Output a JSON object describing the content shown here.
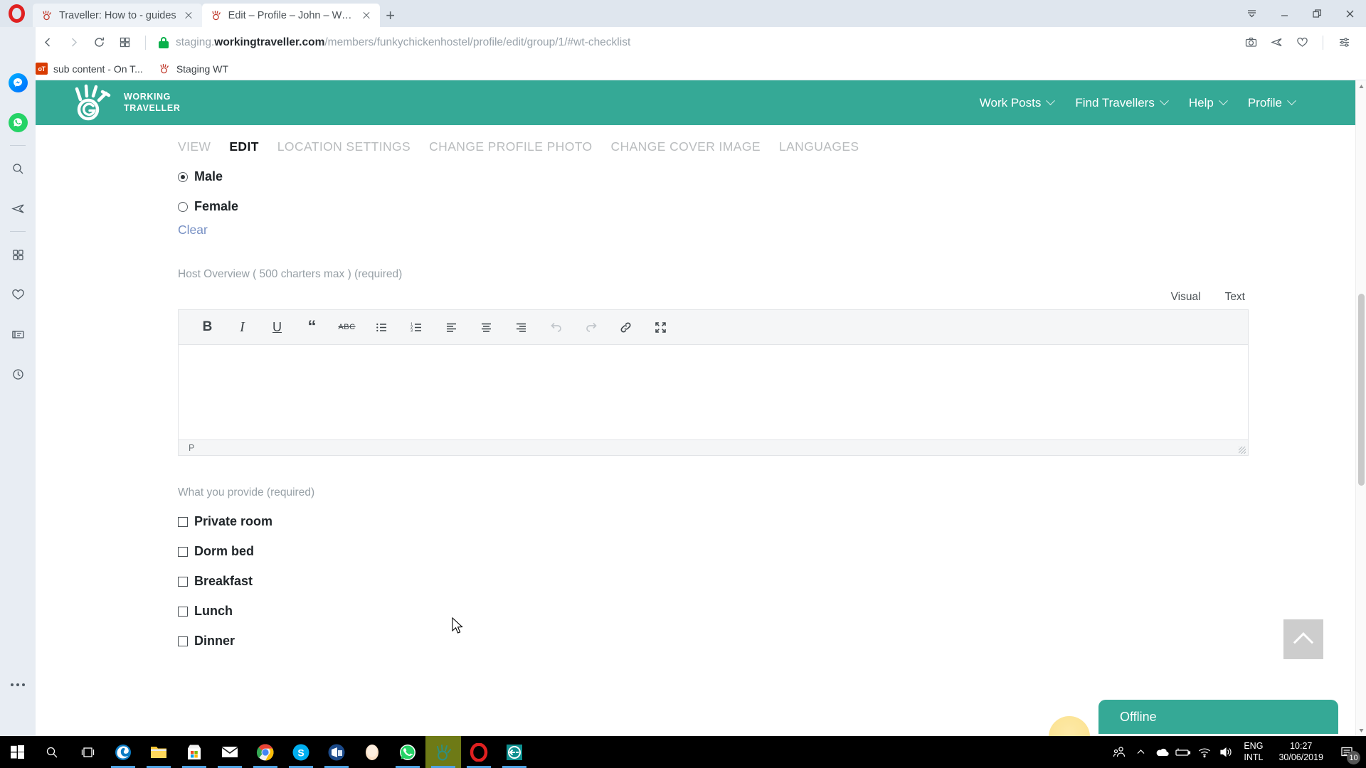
{
  "browser": {
    "name": "Opera",
    "tabs": [
      {
        "title": "Traveller: How to - guides",
        "active": false
      },
      {
        "title": "Edit – Profile – John – Worki",
        "active": true
      }
    ],
    "new_tab_label": "+",
    "url": {
      "scheme_host_prefix": "staging.",
      "host_bold": "workingtraveller.com",
      "path": "/members/funkychickenhostel/profile/edit/group/1/#wt-checklist"
    },
    "bookmarks": [
      {
        "label": "sub content - On T...",
        "icon": "onetastic-icon"
      },
      {
        "label": "Staging WT",
        "icon": "working-traveller-icon"
      }
    ],
    "sidebar_icons": [
      "messenger-icon",
      "whatsapp-icon",
      "search-icon",
      "telegram-icon",
      "speed-dial-icon",
      "bookmarks-heart-icon",
      "news-icon",
      "history-clock-icon",
      "more-dots-icon"
    ],
    "nav_icons": [
      "back-icon",
      "forward-icon",
      "reload-icon",
      "tab-grid-icon"
    ],
    "nav_right_icons": [
      "snapshot-camera-icon",
      "send-icon",
      "heart-icon",
      "easy-setup-icon"
    ],
    "window_controls": [
      "tab-menu-icon",
      "minimize-icon",
      "restore-icon",
      "close-icon"
    ]
  },
  "site": {
    "brand": {
      "line1": "WORKING",
      "line2": "TRAVELLER",
      "accent": "#35a996"
    },
    "nav": [
      {
        "label": "Work Posts"
      },
      {
        "label": "Find Travellers"
      },
      {
        "label": "Help"
      },
      {
        "label": "Profile"
      }
    ],
    "profile_tabs": [
      {
        "label": "VIEW",
        "active": false
      },
      {
        "label": "EDIT",
        "active": true
      },
      {
        "label": "LOCATION SETTINGS",
        "active": false
      },
      {
        "label": "CHANGE PROFILE PHOTO",
        "active": false
      },
      {
        "label": "CHANGE COVER IMAGE",
        "active": false
      },
      {
        "label": "LANGUAGES",
        "active": false
      }
    ],
    "gender": {
      "options": [
        {
          "label": "Male",
          "checked": true
        },
        {
          "label": "Female",
          "checked": false
        }
      ],
      "clear_label": "Clear"
    },
    "host_overview": {
      "label": "Host Overview ( 500 charters max ) (required)",
      "mode_tabs": [
        {
          "label": "Visual",
          "active": true
        },
        {
          "label": "Text",
          "active": false
        }
      ],
      "content": "",
      "path_indicator": "P",
      "toolbar": [
        {
          "name": "bold-icon",
          "glyph": "B",
          "disabled": false
        },
        {
          "name": "italic-icon",
          "glyph": "I",
          "disabled": false
        },
        {
          "name": "underline-icon",
          "glyph": "U",
          "disabled": false
        },
        {
          "name": "blockquote-icon",
          "glyph": "❝",
          "disabled": false
        },
        {
          "name": "strikethrough-icon",
          "glyph": "ABC",
          "disabled": false
        },
        {
          "name": "bulleted-list-icon",
          "glyph": "",
          "disabled": false
        },
        {
          "name": "numbered-list-icon",
          "glyph": "",
          "disabled": false
        },
        {
          "name": "align-left-icon",
          "glyph": "",
          "disabled": false
        },
        {
          "name": "align-center-icon",
          "glyph": "",
          "disabled": false
        },
        {
          "name": "align-right-icon",
          "glyph": "",
          "disabled": false
        },
        {
          "name": "undo-icon",
          "glyph": "",
          "disabled": true
        },
        {
          "name": "redo-icon",
          "glyph": "",
          "disabled": true
        },
        {
          "name": "insert-link-icon",
          "glyph": "",
          "disabled": false
        },
        {
          "name": "fullscreen-icon",
          "glyph": "",
          "disabled": false
        }
      ]
    },
    "what_you_provide": {
      "label": "What you provide (required)",
      "options": [
        {
          "label": "Private room",
          "checked": false
        },
        {
          "label": "Dorm bed",
          "checked": false
        },
        {
          "label": "Breakfast",
          "checked": false
        },
        {
          "label": "Lunch",
          "checked": false
        },
        {
          "label": "Dinner",
          "checked": false
        }
      ]
    },
    "chat_widget": {
      "label": "Offline"
    },
    "scroll_top_button": {
      "name": "scroll-to-top"
    }
  },
  "taskbar": {
    "apps": [
      {
        "name": "start-button"
      },
      {
        "name": "search-icon"
      },
      {
        "name": "task-view-icon"
      },
      {
        "name": "edge-icon"
      },
      {
        "name": "file-explorer-icon"
      },
      {
        "name": "microsoft-store-icon"
      },
      {
        "name": "mail-icon"
      },
      {
        "name": "chrome-icon"
      },
      {
        "name": "skype-icon"
      },
      {
        "name": "outlook-icon"
      },
      {
        "name": "photos-icon"
      },
      {
        "name": "whatsapp-icon"
      },
      {
        "name": "working-traveller-icon"
      },
      {
        "name": "opera-icon"
      },
      {
        "name": "teamviewer-icon"
      }
    ],
    "tray": {
      "icons": [
        "people-icon",
        "show-hidden-icons-chevron",
        "onedrive-icon",
        "battery-icon",
        "wifi-icon",
        "volume-icon"
      ],
      "language_line1": "ENG",
      "language_line2": "INTL",
      "time": "10:27",
      "date": "30/06/2019",
      "notification_count": "10"
    }
  }
}
